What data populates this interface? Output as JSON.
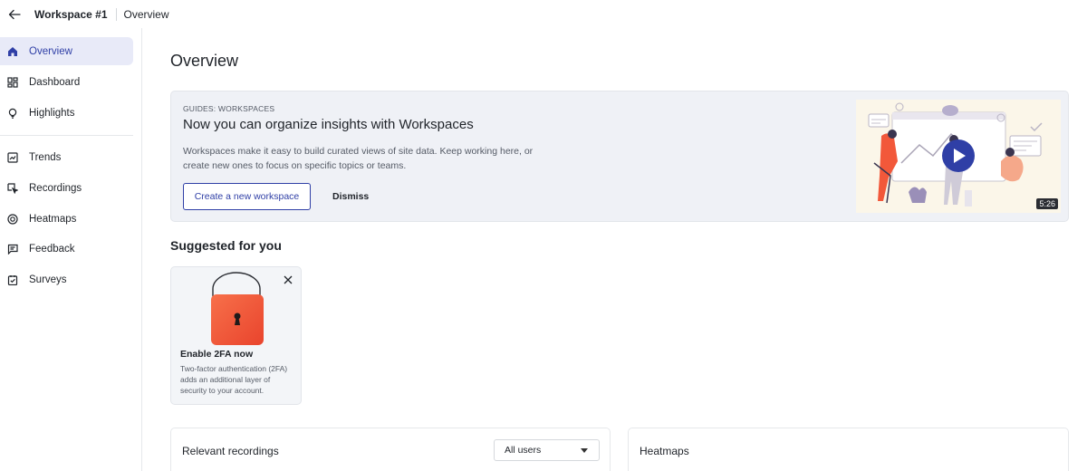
{
  "header": {
    "back_icon": "arrow-left-icon",
    "workspace": "Workspace #1",
    "current_page": "Overview"
  },
  "sidebar": {
    "items": [
      {
        "label": "Overview",
        "icon": "home-icon",
        "active": true
      },
      {
        "label": "Dashboard",
        "icon": "dashboard-grid-icon",
        "active": false
      },
      {
        "label": "Highlights",
        "icon": "lightbulb-icon",
        "active": false
      },
      {
        "label": "Trends",
        "icon": "trend-chart-icon",
        "active": false
      },
      {
        "label": "Recordings",
        "icon": "recording-cursor-icon",
        "active": false
      },
      {
        "label": "Heatmaps",
        "icon": "heatmap-target-icon",
        "active": false
      },
      {
        "label": "Feedback",
        "icon": "feedback-bubble-icon",
        "active": false
      },
      {
        "label": "Surveys",
        "icon": "survey-clipboard-icon",
        "active": false
      }
    ]
  },
  "main": {
    "title": "Overview",
    "guide": {
      "eyebrow": "GUIDES: WORKSPACES",
      "title": "Now you can organize insights with Workspaces",
      "description": "Workspaces make it easy to build curated views of site data. Keep working here, or create new ones to focus on specific topics or teams.",
      "primary_button": "Create a new workspace",
      "secondary_button": "Dismiss",
      "video_duration": "5:26"
    },
    "suggested": {
      "title": "Suggested for you",
      "cards": [
        {
          "icon": "padlock-icon",
          "title": "Enable 2FA now",
          "description": "Two-factor authentication (2FA) adds an additional layer of security to your account."
        }
      ]
    },
    "panels": {
      "recordings": {
        "title": "Relevant recordings",
        "filter_value": "All users"
      },
      "heatmaps": {
        "title": "Heatmaps"
      }
    }
  },
  "colors": {
    "accent": "#2f3fa6",
    "active_nav_bg": "#e8eaf8",
    "banner_bg": "#eff1f6",
    "lock_orange": "#f2583a",
    "play_button": "#2f3fa6"
  }
}
